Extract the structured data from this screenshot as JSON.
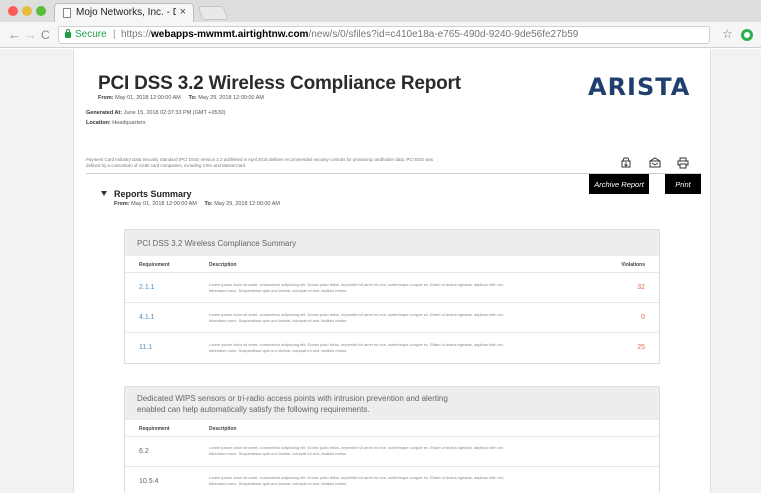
{
  "browser": {
    "tab_title": "Mojo Networks, Inc. - DoD Dire",
    "tab_close": "×",
    "secure_label": "Secure",
    "url_scheme": "https://",
    "url_host": "webapps-mwmmt.airtightnw.com",
    "url_path": "/new/s/0/sfiles?id=c410e18a-e765-490d-9240-9de56fe27b59"
  },
  "report": {
    "title": "PCI DSS 3.2 Wireless Compliance Report",
    "from_label": "From:",
    "from_value": "May 01, 2018 12:00:00 AM",
    "to_label": "To:",
    "to_value": "May 29, 2018 12:00:00 AM",
    "generated_label": "Generated At:",
    "generated_value": "June 15, 2018 02:37:33 PM (GMT +0530)",
    "location_label": "Location:",
    "location_value": "Headquarters",
    "brand": "ARISTA",
    "disclaimer": "Payment Card Industry Data Security Standard (PCI DSS) Version 3.2 published in April 2016 defines recommended security controls for protecting cardholder data. PCI DSS was defined by a consortium of credit card companies, including VISA and MasterCard."
  },
  "actions": {
    "archive_tooltip": "Archive Report",
    "print_tooltip": "Print"
  },
  "summary": {
    "heading": "Reports Summary",
    "from_label": "From:",
    "from_value": "May 01, 2018 12:00:00 AM",
    "to_label": "To:",
    "to_value": "May 29, 2018 12:00:00 AM"
  },
  "compliance_table": {
    "title": "PCI DSS 3.2 Wireless Compliance Summary",
    "columns": [
      "Requirement",
      "Description",
      "Violations"
    ],
    "rows": [
      {
        "requirement": "2.1.1",
        "description": "Lorem ipsum dolor sit amet, consectetur adipiscing elit. Donec justo tellus, imperdiet sit amet mi non, scelerisque congue ex. Etiam ut lectus egestas, dapibus nibh vel, bibendum nunc. Suspendisse quis orci lacinia, volutpat mi sed, facilisis metus.",
        "violations": "32"
      },
      {
        "requirement": "4.1.1",
        "description": "Lorem ipsum dolor sit amet, consectetur adipiscing elit. Donec justo tellus, imperdiet sit amet mi non, scelerisque congue ex. Etiam ut lectus egestas, dapibus nibh vel, bibendum nunc. Suspendisse quis orci lacinia, volutpat mi sed, facilisis metus.",
        "violations": "0"
      },
      {
        "requirement": "11.1",
        "description": "Lorem ipsum dolor sit amet, consectetur adipiscing elit. Donec justo tellus, imperdiet sit amet mi non, scelerisque congue ex. Etiam ut lectus egestas, dapibus nibh vel, bibendum nunc. Suspendisse quis orci lacinia, volutpat mi sed, facilisis metus.",
        "violations": "25"
      }
    ]
  },
  "wips_table": {
    "title_line1": "Dedicated WIPS sensors or tri-radio access points with intrusion prevention and alerting",
    "title_line2": "enabled can help automatically satisfy the following requirements.",
    "columns": [
      "Requirement",
      "Description"
    ],
    "rows": [
      {
        "requirement": "6.2",
        "description": "Lorem ipsum dolor sit amet, consectetur adipiscing elit. Donec justo tellus, imperdiet sit amet mi non, scelerisque congue ex. Etiam ut lectus egestas, dapibus nibh vel, bibendum nunc. Suspendisse quis orci lacinia, volutpat mi sed, facilisis metus."
      },
      {
        "requirement": "10.5.4",
        "description": "Lorem ipsum dolor sit amet, consectetur adipiscing elit. Donec justo tellus, imperdiet sit amet mi non, scelerisque congue ex. Etiam ut lectus egestas, dapibus nibh vel, bibendum nunc. Suspendisse quis orci lacinia, volutpat mi sed, facilisis metus."
      }
    ]
  }
}
